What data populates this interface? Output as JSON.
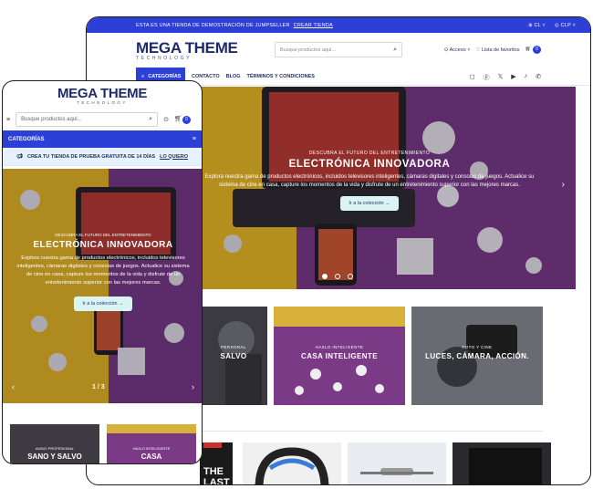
{
  "desktop": {
    "topbar": {
      "promo": "ESTA ES UNA TIENDA DE DEMOSTRACIÓN DE JUMPSELLER",
      "promo_link": "CREAR TIENDA",
      "language": "CL",
      "currency": "CLP"
    },
    "header": {
      "logo_main": "MEGA THEME",
      "logo_sub": "TECHNOLOGY",
      "search_placeholder": "Busque productos aquí...",
      "login": "Acceso",
      "wishlist": "Lista de favoritos",
      "cart_count": "0"
    },
    "nav": {
      "categories": "CATEGORÍAS",
      "links": [
        "CONTACTO",
        "BLOG",
        "TÉRMINOS Y CONDICIONES"
      ],
      "social_icons": [
        "instagram-icon",
        "pinterest-icon",
        "x-icon",
        "youtube-icon",
        "tiktok-icon",
        "whatsapp-icon"
      ]
    },
    "hero": {
      "kicker": "DESCUBRA EL FUTURO DEL ENTRETENIMIENTO",
      "title": "ELECTRÓNICA INNOVADORA",
      "text": "Explora nuestra gama de productos electrónicos, incluidos televisores inteligentes, cámaras digitales y consolas de juegos. Actualice su sistema de cine en casa, capture los momentos de la vida y disfrute de un entretenimiento superior con las mejores marcas.",
      "button": "Ir a la colección →",
      "slides": 3,
      "active_slide": 1
    },
    "cards": [
      {
        "kicker": "PERSONAL",
        "title": "SALVO"
      },
      {
        "kicker": "HAZLO INTELIGENTE",
        "title": "CASA INTELIGENTE"
      },
      {
        "kicker": "FOTO Y CINE",
        "title": "LUCES, CÁMARA, ACCIÓN."
      }
    ],
    "product_label": "THE LAST"
  },
  "mobile": {
    "logo_main": "MEGA THEME",
    "logo_sub": "TECHNOLOGY",
    "search_placeholder": "Busque productos aquí...",
    "cart_count": "0",
    "categories": "CATEGORÍAS",
    "promo": "CREA TU TIENDA DE PRUEBA GRATUITA DE 14 DÍAS",
    "promo_link": "LO QUIERO",
    "hero": {
      "kicker": "DESCUBRA EL FUTURO DEL ENTRETENIMIENTO",
      "title": "ELECTRÓNICA INNOVADORA",
      "text": "Explora nuestra gama de productos electrónicos, incluidos televisores inteligentes, cámaras digitales y consolas de juegos. Actualice su sistema de cine en casa, capture los momentos de la vida y disfrute de un entretenimiento superior con las mejores marcas.",
      "button": "Ir a la colección →",
      "page_current": "1",
      "page_sep": "/",
      "page_total": "3"
    },
    "cards": [
      {
        "kicker": "AUDIO PROFESIONAL",
        "title": "SANO Y SALVO"
      },
      {
        "kicker": "HAZLO INTELIGENTE",
        "title": "CASA"
      }
    ]
  },
  "colors": {
    "brand_blue": "#2c3fd6",
    "logo_navy": "#1e2a6e",
    "hero_yellow": "#f2c21b",
    "hero_purple": "#7b3a86"
  }
}
